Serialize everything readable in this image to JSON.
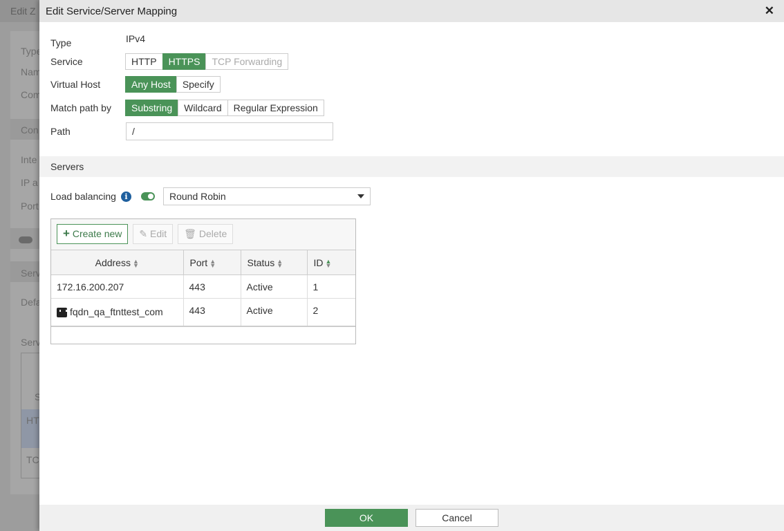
{
  "background": {
    "title": "Edit Z",
    "labels": [
      "Type",
      "Nam",
      "Com",
      "Con",
      "Inte",
      "IP a",
      "Port",
      "Serv",
      "Defa",
      "Serv",
      "S",
      "HT",
      "TC"
    ]
  },
  "dialog": {
    "title": "Edit Service/Server Mapping",
    "type": {
      "label": "Type",
      "value": "IPv4"
    },
    "service": {
      "label": "Service",
      "options": [
        "HTTP",
        "HTTPS",
        "TCP Forwarding"
      ],
      "selected": "HTTPS"
    },
    "virtual_host": {
      "label": "Virtual Host",
      "options": [
        "Any Host",
        "Specify"
      ],
      "selected": "Any Host"
    },
    "match_path": {
      "label": "Match path by",
      "options": [
        "Substring",
        "Wildcard",
        "Regular Expression"
      ],
      "selected": "Substring"
    },
    "path": {
      "label": "Path",
      "value": "/"
    },
    "servers_section": "Servers",
    "load_balancing": {
      "label": "Load balancing",
      "enabled": true,
      "method": "Round Robin"
    },
    "toolbar": {
      "create": "Create new",
      "edit": "Edit",
      "delete": "Delete"
    },
    "columns": [
      "Address",
      "Port",
      "Status",
      "ID"
    ],
    "rows": [
      {
        "address": "172.16.200.207",
        "port": "443",
        "status": "Active",
        "id": "1"
      },
      {
        "address": "fqdn_qa_ftnttest_com",
        "port": "443",
        "status": "Active",
        "id": "2"
      }
    ],
    "ok": "OK",
    "cancel": "Cancel"
  },
  "colors": {
    "accent": "#4a9358",
    "info": "#1e5f9e"
  }
}
